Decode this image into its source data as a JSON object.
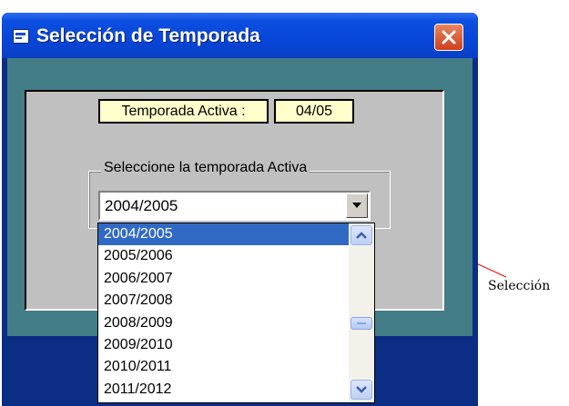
{
  "window": {
    "title": "Selección de Temporada",
    "close_label": "×"
  },
  "active_season": {
    "label": "Temporada Activa :",
    "value": "04/05"
  },
  "season_group": {
    "legend": "Seleccione la temporada Activa",
    "combo_value": "2004/2005",
    "options": [
      "2004/2005",
      "2005/2006",
      "2006/2007",
      "2007/2008",
      "2008/2009",
      "2009/2010",
      "2010/2011",
      "2011/2012"
    ],
    "selected_index": 0
  },
  "annotation": {
    "text": "Selección"
  },
  "colors": {
    "titlebar": "#0a46d8",
    "client_background": "#437d88",
    "panel": "#c0c0c0",
    "label_background": "#ffffcc",
    "selection": "#316ac5",
    "leader_line": "#ff0000"
  }
}
